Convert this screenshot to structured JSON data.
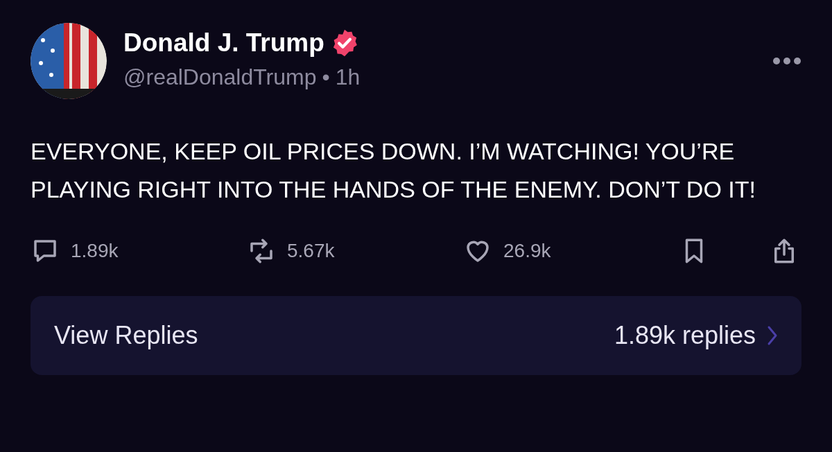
{
  "post": {
    "author": "Donald J. Trump",
    "verified": true,
    "handle": "@realDonaldTrump",
    "separator": "•",
    "time": "1h",
    "text": "EVERYONE, KEEP OIL PRICES DOWN. I’M WATCHING! YOU’RE PLAYING RIGHT INTO THE HANDS OF THE ENEMY. DON’T DO IT!",
    "actions": [
      {
        "kind": "reply",
        "count": "1.89k"
      },
      {
        "kind": "repost",
        "count": "5.67k"
      },
      {
        "kind": "like",
        "count": "26.9k"
      },
      {
        "kind": "bookmark"
      },
      {
        "kind": "share"
      }
    ]
  },
  "replies_bar": {
    "label": "View Replies",
    "count": "1.89k replies"
  }
}
